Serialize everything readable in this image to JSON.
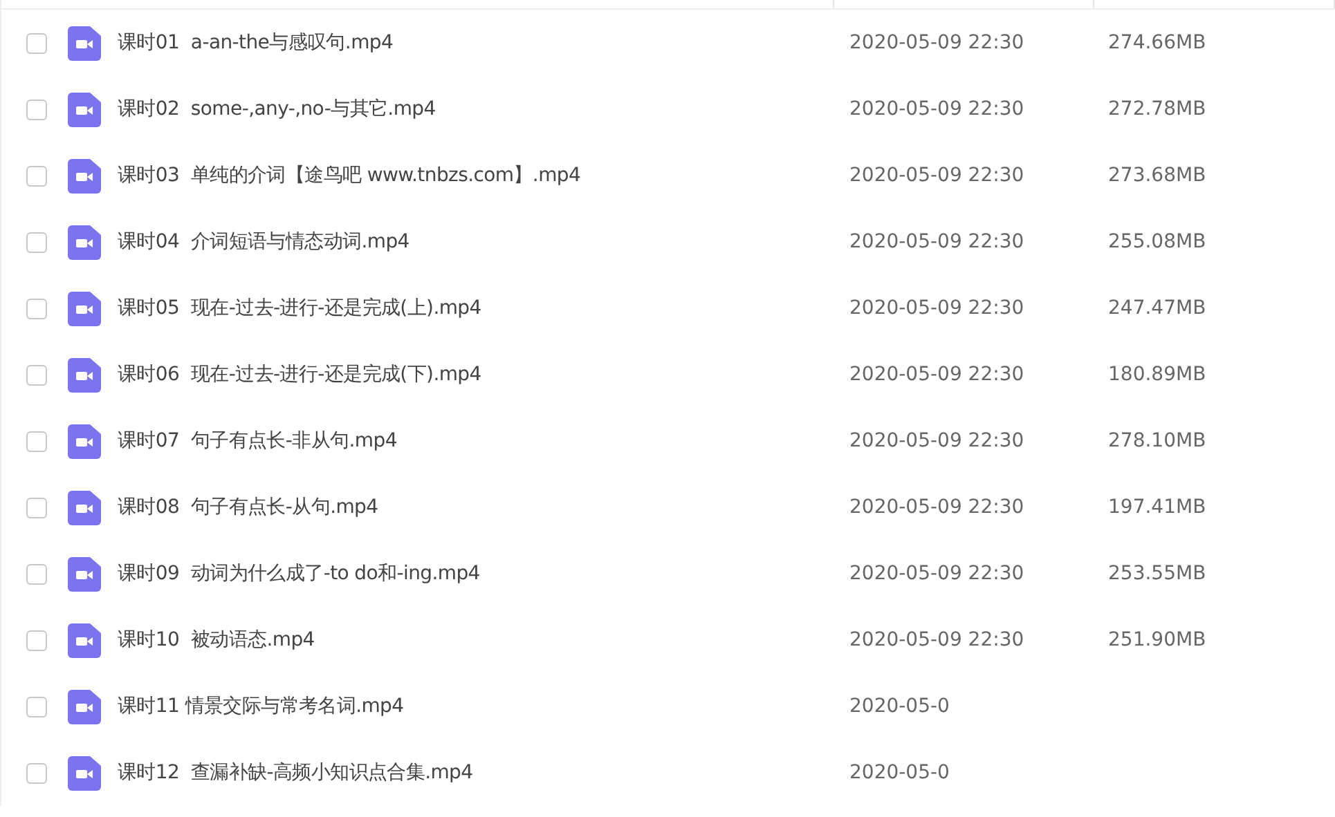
{
  "files": [
    {
      "name": "课时01  a-an-the与感叹句.mp4",
      "date": "2020-05-09 22:30",
      "size": "274.66MB",
      "checked": false
    },
    {
      "name": "课时02  some-,any-,no-与其它.mp4",
      "date": "2020-05-09 22:30",
      "size": "272.78MB",
      "checked": false
    },
    {
      "name": "课时03  单纯的介词【途鸟吧 www.tnbzs.com】.mp4",
      "date": "2020-05-09 22:30",
      "size": "273.68MB",
      "checked": false
    },
    {
      "name": "课时04  介词短语与情态动词.mp4",
      "date": "2020-05-09 22:30",
      "size": "255.08MB",
      "checked": false
    },
    {
      "name": "课时05  现在-过去-进行-还是完成(上).mp4",
      "date": "2020-05-09 22:30",
      "size": "247.47MB",
      "checked": false
    },
    {
      "name": "课时06  现在-过去-进行-还是完成(下).mp4",
      "date": "2020-05-09 22:30",
      "size": "180.89MB",
      "checked": false
    },
    {
      "name": "课时07  句子有点长-非从句.mp4",
      "date": "2020-05-09 22:30",
      "size": "278.10MB",
      "checked": false
    },
    {
      "name": "课时08  句子有点长-从句.mp4",
      "date": "2020-05-09 22:30",
      "size": "197.41MB",
      "checked": false
    },
    {
      "name": "课时09  动词为什么成了-to do和-ing.mp4",
      "date": "2020-05-09 22:30",
      "size": "253.55MB",
      "checked": false
    },
    {
      "name": "课时10  被动语态.mp4",
      "date": "2020-05-09 22:30",
      "size": "251.90MB",
      "checked": false
    },
    {
      "name": "课时11 情景交际与常考名词.mp4",
      "date": "2020-05-0",
      "checked": false
    },
    {
      "name": "课时12  查漏补缺-高频小知识点合集.mp4",
      "date": "2020-05-0",
      "checked": false
    }
  ]
}
